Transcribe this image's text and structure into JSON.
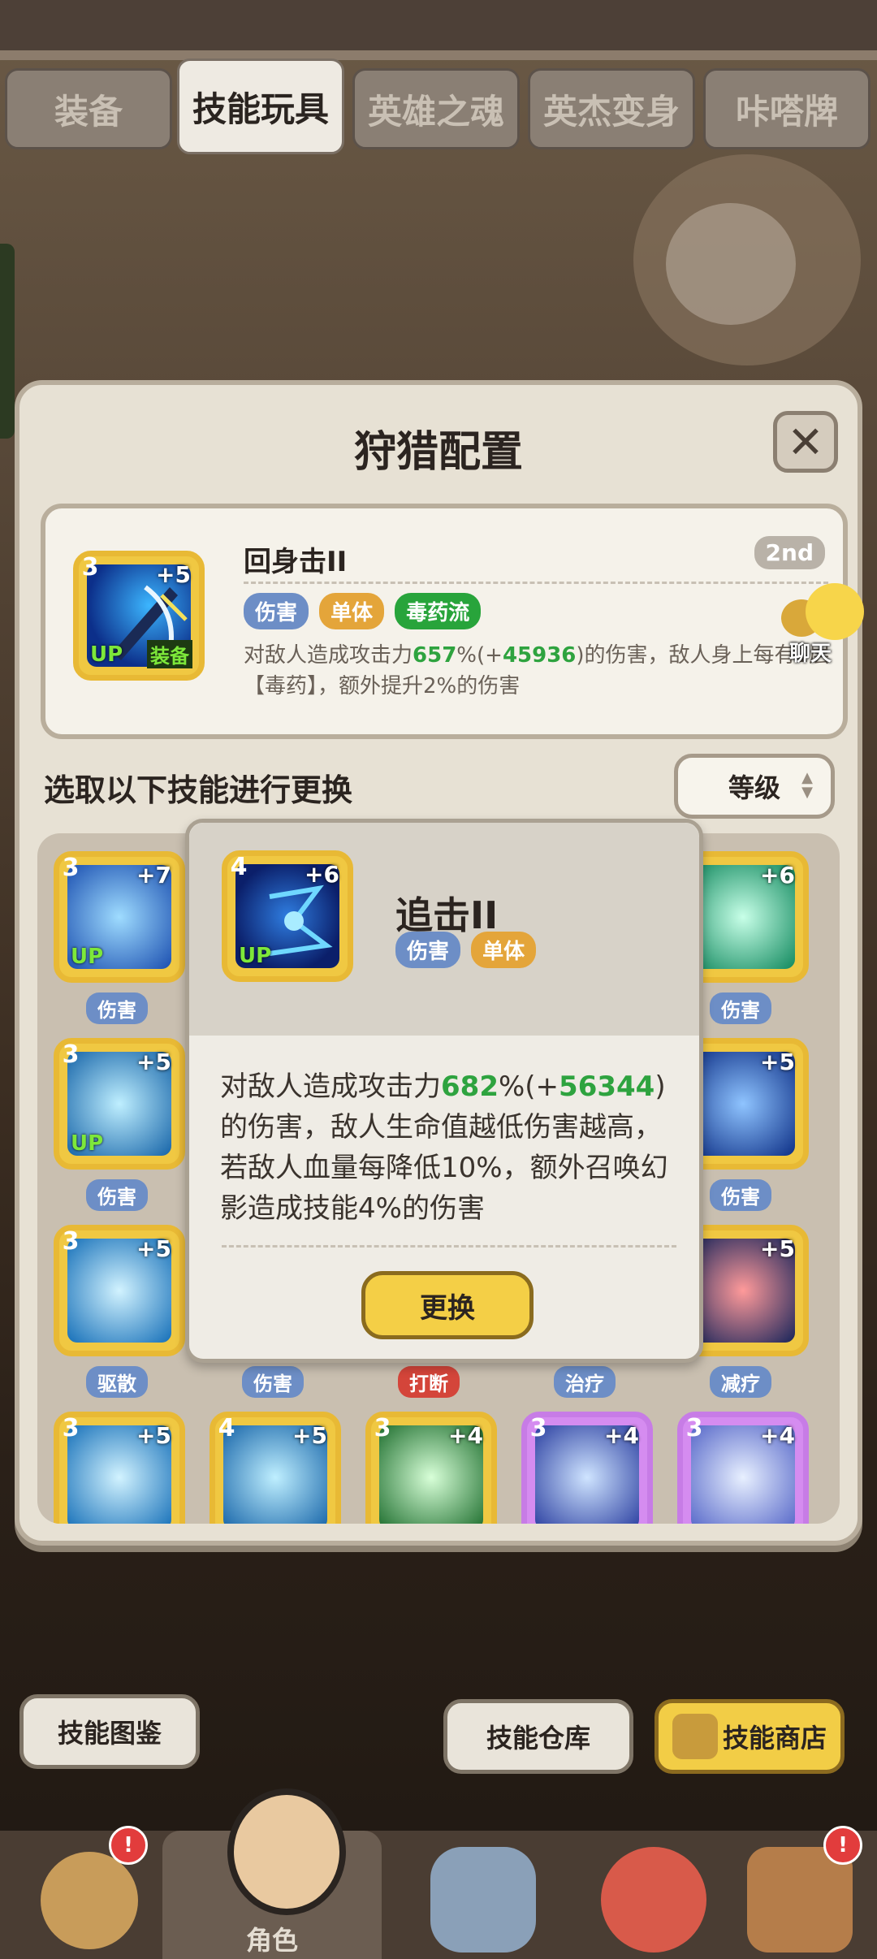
{
  "tabs": [
    "装备",
    "技能玩具",
    "英雄之魂",
    "英杰变身",
    "咔嗒牌"
  ],
  "active_tab": "技能玩具",
  "modal": {
    "title": "狩猎配置",
    "close_label": "✕",
    "current_skill": {
      "level": "3",
      "plus": "+5",
      "up": "UP",
      "equipped": "装备",
      "name": "回身击II",
      "rank": "2nd",
      "tags": [
        "伤害",
        "单体",
        "毒药流"
      ],
      "desc_pre": "对敌人造成攻击力",
      "desc_pct": "657",
      "desc_mid": "%(+",
      "desc_val": "45936",
      "desc_post": ")的伤害，敌人身上每有1层",
      "desc_line2": "【毒药】，额外提升2%的伤害"
    },
    "select_label": "选取以下技能进行更换",
    "sort_label": "等级"
  },
  "chat": {
    "label": "聊天"
  },
  "grid": {
    "tiles": [
      {
        "level": "3",
        "plus": "+7",
        "up": "UP",
        "label": "伤害"
      },
      {
        "level": "",
        "plus": "+6",
        "up": "",
        "label": "伤害"
      },
      {
        "level": "3",
        "plus": "+5",
        "up": "UP",
        "label": "伤害"
      },
      {
        "level": "",
        "plus": "+5",
        "up": "",
        "label": "伤害"
      },
      {
        "level": "3",
        "plus": "+5",
        "up": "",
        "label": "驱散"
      },
      {
        "level": "",
        "plus": "",
        "up": "",
        "label": "伤害"
      },
      {
        "level": "",
        "plus": "",
        "up": "",
        "label": "打断"
      },
      {
        "level": "",
        "plus": "",
        "up": "",
        "label": "治疗"
      },
      {
        "level": "",
        "plus": "+5",
        "up": "",
        "label": "减疗"
      },
      {
        "level": "3",
        "plus": "+5",
        "up": ""
      },
      {
        "level": "4",
        "plus": "+5",
        "up": ""
      },
      {
        "level": "3",
        "plus": "+4",
        "up": ""
      },
      {
        "level": "3",
        "plus": "+4",
        "up": ""
      },
      {
        "level": "3",
        "plus": "+4",
        "up": ""
      }
    ]
  },
  "popup": {
    "level": "4",
    "plus": "+6",
    "up": "UP",
    "name": "追击II",
    "tags": [
      "伤害",
      "单体"
    ],
    "desc_pre": "对敌人造成攻击力",
    "desc_pct": "682",
    "desc_mid": "%(+",
    "desc_val": "56344",
    "desc_post": ")的伤害，敌人生命值越低伤害越高，若敌人血量每降低10%，额外召唤幻影造成技能4%的伤害",
    "button": "更换"
  },
  "bottom_buttons": {
    "handbook": "技能图鉴",
    "warehouse": "技能仓库",
    "shop": "技能商店"
  },
  "bottom_nav": {
    "items": [
      "",
      "角色",
      "",
      "",
      ""
    ],
    "active": "角色",
    "badge_1": "!",
    "badge_5": "!"
  },
  "colors": {
    "accent_gold": "#f4cf46",
    "highlight_green": "#2ea33f",
    "tag_blue": "#6d8ec6",
    "tag_gold": "#e4a53a",
    "tag_green": "#28a43b",
    "tag_red": "#d4453a"
  }
}
